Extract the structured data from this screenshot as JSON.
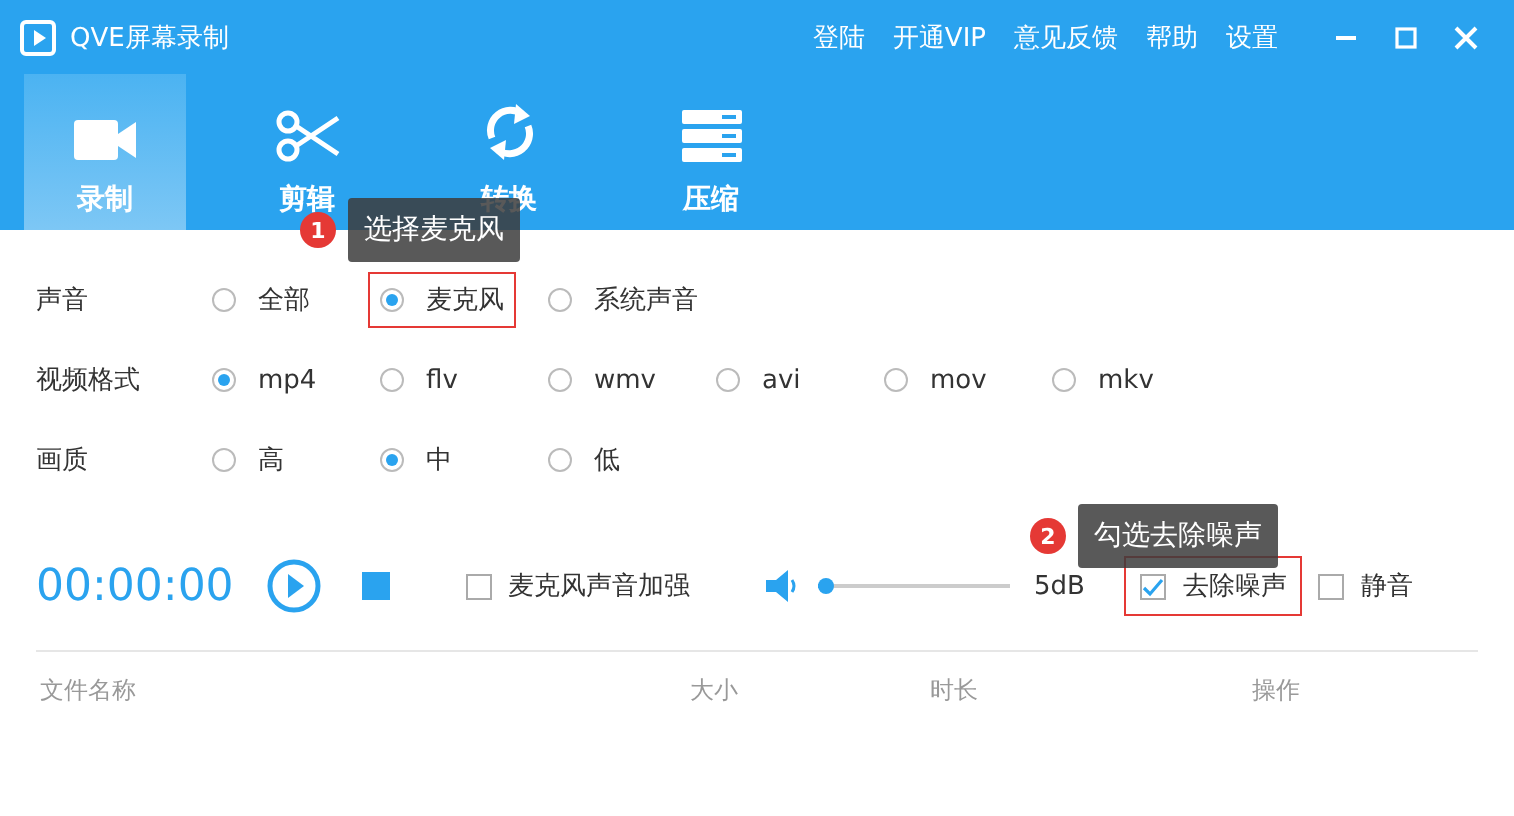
{
  "window": {
    "title": "QVE屏幕录制"
  },
  "header_links": [
    "登陆",
    "开通VIP",
    "意见反馈",
    "帮助",
    "设置"
  ],
  "tabs": [
    {
      "label": "录制",
      "selected": true
    },
    {
      "label": "剪辑",
      "selected": false
    },
    {
      "label": "转换",
      "selected": false
    },
    {
      "label": "压缩",
      "selected": false
    }
  ],
  "settings": [
    {
      "label": "声音",
      "options": [
        {
          "label": "全部",
          "selected": false,
          "highlighted": false
        },
        {
          "label": "麦克风",
          "selected": true,
          "highlighted": true
        },
        {
          "label": "系统声音",
          "selected": false,
          "highlighted": false
        }
      ]
    },
    {
      "label": "视频格式",
      "options": [
        {
          "label": "mp4",
          "selected": true,
          "highlighted": false
        },
        {
          "label": "flv",
          "selected": false,
          "highlighted": false
        },
        {
          "label": "wmv",
          "selected": false,
          "highlighted": false
        },
        {
          "label": "avi",
          "selected": false,
          "highlighted": false
        },
        {
          "label": "mov",
          "selected": false,
          "highlighted": false
        },
        {
          "label": "mkv",
          "selected": false,
          "highlighted": false
        }
      ]
    },
    {
      "label": "画质",
      "options": [
        {
          "label": "高",
          "selected": false,
          "highlighted": false
        },
        {
          "label": "中",
          "selected": true,
          "highlighted": false
        },
        {
          "label": "低",
          "selected": false,
          "highlighted": false
        }
      ]
    }
  ],
  "recorder": {
    "time": "00:00:00",
    "mic_boost": {
      "label": "麦克风声音加强",
      "checked": false,
      "highlighted": false
    },
    "volume": {
      "level": 0.04,
      "reading": "5dB"
    },
    "after": [
      {
        "label": "去除噪声",
        "checked": true,
        "highlighted": true
      },
      {
        "label": "静音",
        "checked": false,
        "highlighted": false
      }
    ]
  },
  "file_table": {
    "columns": [
      "文件名称",
      "大小",
      "时长",
      "操作"
    ]
  },
  "callouts": [
    {
      "number": "1",
      "text": "选择麦克风"
    },
    {
      "number": "2",
      "text": "勾选去除噪声"
    }
  ]
}
